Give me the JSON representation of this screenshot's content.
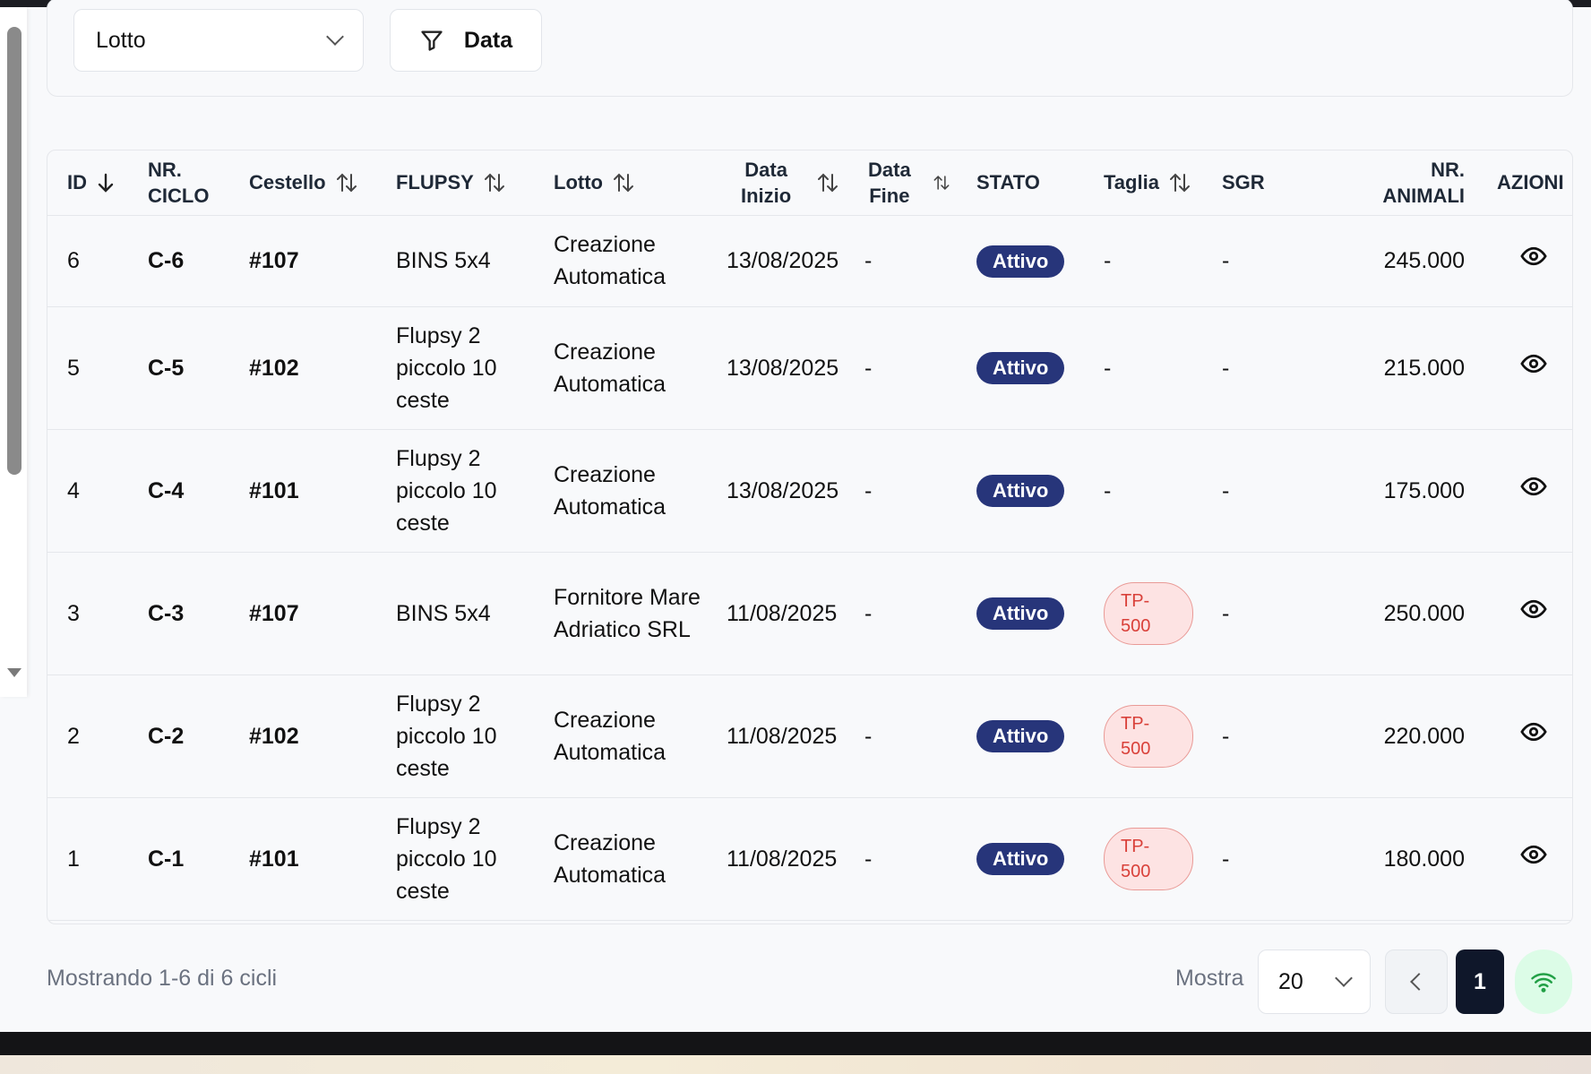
{
  "filters": {
    "lotto_select": "Lotto",
    "data_button": "Data"
  },
  "table": {
    "headers": {
      "id": "ID",
      "nr_ciclo_1": "NR.",
      "nr_ciclo_2": "CICLO",
      "cestello": "Cestello",
      "flupsy": "FLUPSY",
      "lotto": "Lotto",
      "data_inizio_1": "Data",
      "data_inizio_2": "Inizio",
      "data_fine_1": "Data",
      "data_fine_2": "Fine",
      "stato": "STATO",
      "taglia": "Taglia",
      "sgr": "SGR",
      "nr_animali_1": "NR.",
      "nr_animali_2": "ANIMALI",
      "azioni": "AZIONI"
    },
    "rows": [
      {
        "id": "6",
        "ciclo": "C-6",
        "cestello": "#107",
        "flupsy": "BINS 5x4",
        "lotto": "Creazione Automatica",
        "data_inizio": "13/08/2025",
        "data_fine": "-",
        "stato": "Attivo",
        "taglia": "-",
        "sgr": "-",
        "animali": "245.000"
      },
      {
        "id": "5",
        "ciclo": "C-5",
        "cestello": "#102",
        "flupsy": "Flupsy 2 piccolo 10 ceste",
        "lotto": "Creazione Automatica",
        "data_inizio": "13/08/2025",
        "data_fine": "-",
        "stato": "Attivo",
        "taglia": "-",
        "sgr": "-",
        "animali": "215.000"
      },
      {
        "id": "4",
        "ciclo": "C-4",
        "cestello": "#101",
        "flupsy": "Flupsy 2 piccolo 10 ceste",
        "lotto": "Creazione Automatica",
        "data_inizio": "13/08/2025",
        "data_fine": "-",
        "stato": "Attivo",
        "taglia": "-",
        "sgr": "-",
        "animali": "175.000"
      },
      {
        "id": "3",
        "ciclo": "C-3",
        "cestello": "#107",
        "flupsy": "BINS 5x4",
        "lotto": "Fornitore Mare Adriatico SRL",
        "data_inizio": "11/08/2025",
        "data_fine": "-",
        "stato": "Attivo",
        "taglia": "TP-500",
        "sgr": "-",
        "animali": "250.000"
      },
      {
        "id": "2",
        "ciclo": "C-2",
        "cestello": "#102",
        "flupsy": "Flupsy 2 piccolo 10 ceste",
        "lotto": "Creazione Automatica",
        "data_inizio": "11/08/2025",
        "data_fine": "-",
        "stato": "Attivo",
        "taglia": "TP-500",
        "sgr": "-",
        "animali": "220.000"
      },
      {
        "id": "1",
        "ciclo": "C-1",
        "cestello": "#101",
        "flupsy": "Flupsy 2 piccolo 10 ceste",
        "lotto": "Creazione Automatica",
        "data_inizio": "11/08/2025",
        "data_fine": "-",
        "stato": "Attivo",
        "taglia": "TP-500",
        "sgr": "-",
        "animali": "180.000"
      }
    ]
  },
  "footer": {
    "summary": "Mostrando 1-6 di 6 cicli",
    "mostra_label": "Mostra",
    "page_size": "20",
    "current_page": "1"
  },
  "colors": {
    "badge_attivo": "#27357a",
    "badge_tp": "#fde3e3",
    "page_active": "#0f172a",
    "wifi_bg": "#dcfce7"
  },
  "icons": [
    "chevron-down-icon",
    "filter-icon",
    "sort-desc-icon",
    "sort-icon",
    "eye-icon",
    "chevron-left-icon",
    "wifi-icon"
  ]
}
